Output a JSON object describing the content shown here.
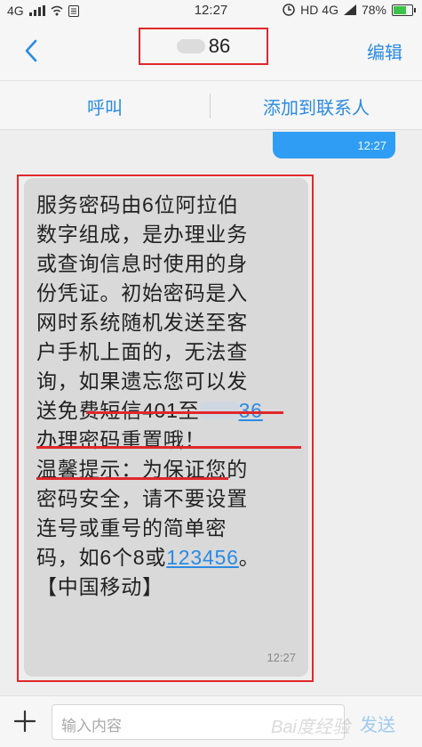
{
  "status_bar": {
    "signal_left": "4G",
    "time": "12:27",
    "right": "HD 4G",
    "battery": "78%",
    "battery_level": 0.78
  },
  "header": {
    "title_suffix": "86",
    "edit_label": "编辑"
  },
  "actions": {
    "call_label": "呼叫",
    "add_contact_label": "添加到联系人"
  },
  "sent_message": {
    "time": "12:27"
  },
  "received_message": {
    "lines": [
      "服务密码由6位阿拉伯",
      "数字组成，是办理业务",
      "或查询信息时使用的身",
      "份凭证。初始密码是入",
      "网时系统随机发送至客",
      "户手机上面的，无法查"
    ],
    "line7": "询，如果遗忘您可以发",
    "line8_prefix": "送免费短信401至",
    "line8_link_suffix": "36",
    "line9": "办理密码重置哦！",
    "line10": "温馨提示：为保证您的",
    "line11": "密码安全，请不要设置",
    "line12": "连号或重号的简单密",
    "line13_prefix": "码，如6个8或",
    "line13_link": "123456",
    "line13_suffix": "。",
    "line14": "【中国移动】",
    "time": "12:27"
  },
  "input_bar": {
    "placeholder": "输入内容",
    "send_label": "发送"
  },
  "watermark": "Bai度经验",
  "colors": {
    "accent": "#2a8be3",
    "highlight_red": "#e0282b",
    "sent_bubble": "#2f9df4",
    "received_bubble": "#d9d9d9"
  }
}
